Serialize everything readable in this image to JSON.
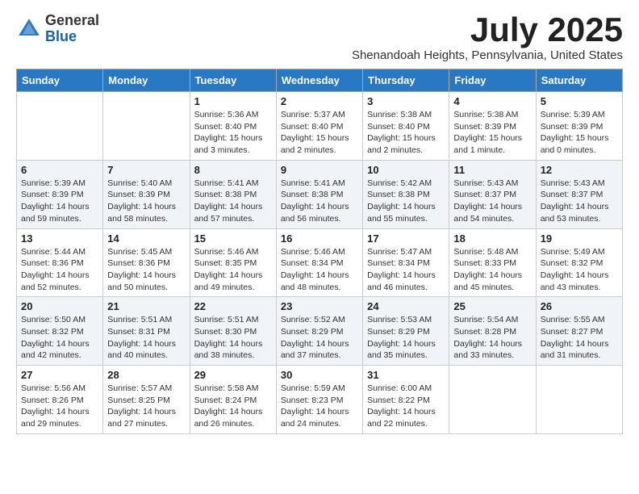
{
  "header": {
    "logo_general": "General",
    "logo_blue": "Blue",
    "month_title": "July 2025",
    "subtitle": "Shenandoah Heights, Pennsylvania, United States"
  },
  "weekdays": [
    "Sunday",
    "Monday",
    "Tuesday",
    "Wednesday",
    "Thursday",
    "Friday",
    "Saturday"
  ],
  "weeks": [
    [
      {
        "day": "",
        "sunrise": "",
        "sunset": "",
        "daylight": ""
      },
      {
        "day": "",
        "sunrise": "",
        "sunset": "",
        "daylight": ""
      },
      {
        "day": "1",
        "sunrise": "Sunrise: 5:36 AM",
        "sunset": "Sunset: 8:40 PM",
        "daylight": "Daylight: 15 hours and 3 minutes."
      },
      {
        "day": "2",
        "sunrise": "Sunrise: 5:37 AM",
        "sunset": "Sunset: 8:40 PM",
        "daylight": "Daylight: 15 hours and 2 minutes."
      },
      {
        "day": "3",
        "sunrise": "Sunrise: 5:38 AM",
        "sunset": "Sunset: 8:40 PM",
        "daylight": "Daylight: 15 hours and 2 minutes."
      },
      {
        "day": "4",
        "sunrise": "Sunrise: 5:38 AM",
        "sunset": "Sunset: 8:39 PM",
        "daylight": "Daylight: 15 hours and 1 minute."
      },
      {
        "day": "5",
        "sunrise": "Sunrise: 5:39 AM",
        "sunset": "Sunset: 8:39 PM",
        "daylight": "Daylight: 15 hours and 0 minutes."
      }
    ],
    [
      {
        "day": "6",
        "sunrise": "Sunrise: 5:39 AM",
        "sunset": "Sunset: 8:39 PM",
        "daylight": "Daylight: 14 hours and 59 minutes."
      },
      {
        "day": "7",
        "sunrise": "Sunrise: 5:40 AM",
        "sunset": "Sunset: 8:39 PM",
        "daylight": "Daylight: 14 hours and 58 minutes."
      },
      {
        "day": "8",
        "sunrise": "Sunrise: 5:41 AM",
        "sunset": "Sunset: 8:38 PM",
        "daylight": "Daylight: 14 hours and 57 minutes."
      },
      {
        "day": "9",
        "sunrise": "Sunrise: 5:41 AM",
        "sunset": "Sunset: 8:38 PM",
        "daylight": "Daylight: 14 hours and 56 minutes."
      },
      {
        "day": "10",
        "sunrise": "Sunrise: 5:42 AM",
        "sunset": "Sunset: 8:38 PM",
        "daylight": "Daylight: 14 hours and 55 minutes."
      },
      {
        "day": "11",
        "sunrise": "Sunrise: 5:43 AM",
        "sunset": "Sunset: 8:37 PM",
        "daylight": "Daylight: 14 hours and 54 minutes."
      },
      {
        "day": "12",
        "sunrise": "Sunrise: 5:43 AM",
        "sunset": "Sunset: 8:37 PM",
        "daylight": "Daylight: 14 hours and 53 minutes."
      }
    ],
    [
      {
        "day": "13",
        "sunrise": "Sunrise: 5:44 AM",
        "sunset": "Sunset: 8:36 PM",
        "daylight": "Daylight: 14 hours and 52 minutes."
      },
      {
        "day": "14",
        "sunrise": "Sunrise: 5:45 AM",
        "sunset": "Sunset: 8:36 PM",
        "daylight": "Daylight: 14 hours and 50 minutes."
      },
      {
        "day": "15",
        "sunrise": "Sunrise: 5:46 AM",
        "sunset": "Sunset: 8:35 PM",
        "daylight": "Daylight: 14 hours and 49 minutes."
      },
      {
        "day": "16",
        "sunrise": "Sunrise: 5:46 AM",
        "sunset": "Sunset: 8:34 PM",
        "daylight": "Daylight: 14 hours and 48 minutes."
      },
      {
        "day": "17",
        "sunrise": "Sunrise: 5:47 AM",
        "sunset": "Sunset: 8:34 PM",
        "daylight": "Daylight: 14 hours and 46 minutes."
      },
      {
        "day": "18",
        "sunrise": "Sunrise: 5:48 AM",
        "sunset": "Sunset: 8:33 PM",
        "daylight": "Daylight: 14 hours and 45 minutes."
      },
      {
        "day": "19",
        "sunrise": "Sunrise: 5:49 AM",
        "sunset": "Sunset: 8:32 PM",
        "daylight": "Daylight: 14 hours and 43 minutes."
      }
    ],
    [
      {
        "day": "20",
        "sunrise": "Sunrise: 5:50 AM",
        "sunset": "Sunset: 8:32 PM",
        "daylight": "Daylight: 14 hours and 42 minutes."
      },
      {
        "day": "21",
        "sunrise": "Sunrise: 5:51 AM",
        "sunset": "Sunset: 8:31 PM",
        "daylight": "Daylight: 14 hours and 40 minutes."
      },
      {
        "day": "22",
        "sunrise": "Sunrise: 5:51 AM",
        "sunset": "Sunset: 8:30 PM",
        "daylight": "Daylight: 14 hours and 38 minutes."
      },
      {
        "day": "23",
        "sunrise": "Sunrise: 5:52 AM",
        "sunset": "Sunset: 8:29 PM",
        "daylight": "Daylight: 14 hours and 37 minutes."
      },
      {
        "day": "24",
        "sunrise": "Sunrise: 5:53 AM",
        "sunset": "Sunset: 8:29 PM",
        "daylight": "Daylight: 14 hours and 35 minutes."
      },
      {
        "day": "25",
        "sunrise": "Sunrise: 5:54 AM",
        "sunset": "Sunset: 8:28 PM",
        "daylight": "Daylight: 14 hours and 33 minutes."
      },
      {
        "day": "26",
        "sunrise": "Sunrise: 5:55 AM",
        "sunset": "Sunset: 8:27 PM",
        "daylight": "Daylight: 14 hours and 31 minutes."
      }
    ],
    [
      {
        "day": "27",
        "sunrise": "Sunrise: 5:56 AM",
        "sunset": "Sunset: 8:26 PM",
        "daylight": "Daylight: 14 hours and 29 minutes."
      },
      {
        "day": "28",
        "sunrise": "Sunrise: 5:57 AM",
        "sunset": "Sunset: 8:25 PM",
        "daylight": "Daylight: 14 hours and 27 minutes."
      },
      {
        "day": "29",
        "sunrise": "Sunrise: 5:58 AM",
        "sunset": "Sunset: 8:24 PM",
        "daylight": "Daylight: 14 hours and 26 minutes."
      },
      {
        "day": "30",
        "sunrise": "Sunrise: 5:59 AM",
        "sunset": "Sunset: 8:23 PM",
        "daylight": "Daylight: 14 hours and 24 minutes."
      },
      {
        "day": "31",
        "sunrise": "Sunrise: 6:00 AM",
        "sunset": "Sunset: 8:22 PM",
        "daylight": "Daylight: 14 hours and 22 minutes."
      },
      {
        "day": "",
        "sunrise": "",
        "sunset": "",
        "daylight": ""
      },
      {
        "day": "",
        "sunrise": "",
        "sunset": "",
        "daylight": ""
      }
    ]
  ]
}
